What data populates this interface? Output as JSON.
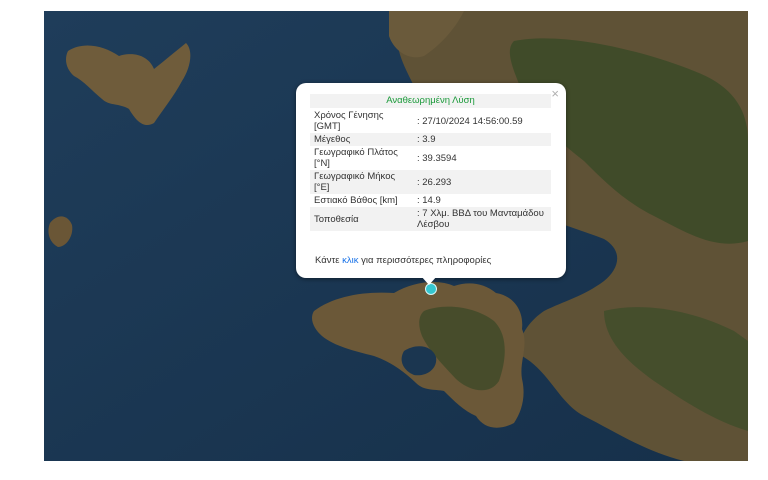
{
  "colors": {
    "sea": "#1d3a55",
    "land": "#6e5b3c",
    "forest": "#3c4a27",
    "title_green": "#1b9a3a",
    "link_blue": "#1a73e8",
    "marker": "#35c6cf"
  },
  "popup": {
    "title": "Αναθεωρημένη Λύση",
    "close_icon": "×",
    "rows": [
      {
        "label": "Χρόνος Γένησης [GMT]",
        "value": ": 27/10/2024 14:56:00.59"
      },
      {
        "label": "Μέγεθος",
        "value": ": 3.9"
      },
      {
        "label": "Γεωγραφικό Πλάτος [°N]",
        "value": ": 39.3594"
      },
      {
        "label": "Γεωγραφικό Μήκος [°E]",
        "value": ": 26.293"
      },
      {
        "label": "Εστιακό Βάθος [km]",
        "value": ": 14.9"
      },
      {
        "label": "Τοποθεσία",
        "value": ": 7 Χλμ. ΒΒΔ του Μανταμάδου Λέσβου"
      }
    ],
    "more_prefix": "Κάντε ",
    "more_link": "κλικ",
    "more_suffix": " για περισσότερες πληροφορίες"
  }
}
